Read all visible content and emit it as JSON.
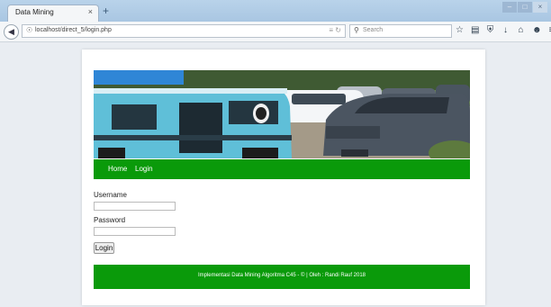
{
  "browser": {
    "tab_title": "Data Mining",
    "tab_close": "×",
    "new_tab": "+",
    "url": "localhost/direct_5/login.php",
    "search_placeholder": "Search",
    "win_minimize": "–",
    "win_maximize": "□",
    "win_close": "×",
    "icons": [
      "back-arrow-icon",
      "globe-icon",
      "reader-icon",
      "reload-icon",
      "search-icon",
      "star-icon",
      "clipboard-icon",
      "shield-icon",
      "download-icon",
      "home-icon",
      "smiley-icon",
      "menu-icon"
    ]
  },
  "page": {
    "banner_alt_desc": "parked minibuses and cars",
    "nav": {
      "home": "Home",
      "login": "Login"
    },
    "form": {
      "username_label": "Username",
      "username_value": "",
      "password_label": "Password",
      "password_value": "",
      "submit_label": "Login"
    },
    "footer": "Implementasi Data Mining Algoritma C45 - © | Oleh : Randi Rauf 2018"
  },
  "colors": {
    "accent_green": "#0a9a0a",
    "tabbar": "#b9d3ea",
    "page_bg": "#e9edf2"
  }
}
